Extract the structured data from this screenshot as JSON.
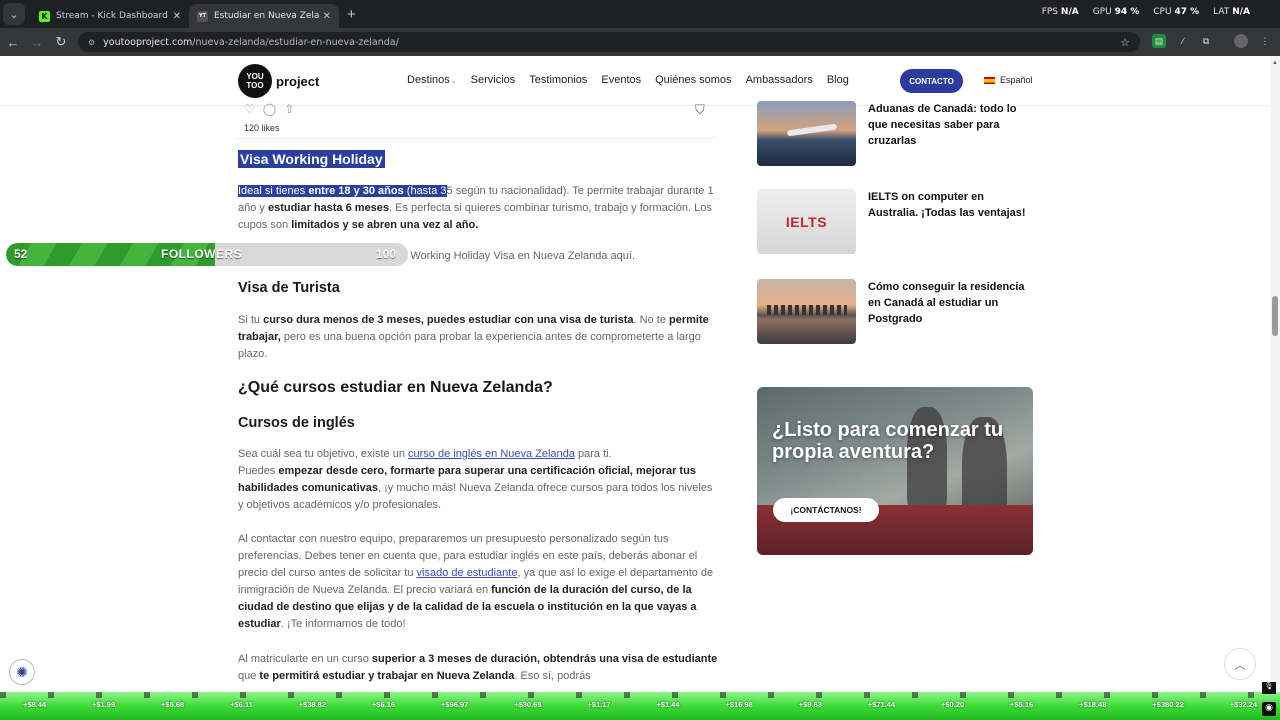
{
  "browser": {
    "tabs": [
      {
        "title": "Stream - Kick Dashboard",
        "favicon": "K"
      },
      {
        "title": "Estudiar en Nueva Zelanda con",
        "favicon": "YT"
      }
    ],
    "new_tab": "+",
    "stats": {
      "fps_label": "FPS",
      "fps_value": "N/A",
      "gpu_label": "GPU",
      "gpu_value": "94 %",
      "cpu_label": "CPU",
      "cpu_value": "47 %",
      "lat_label": "LAT",
      "lat_value": "N/A"
    },
    "url_host": "youtooproject.com",
    "url_path": "/nueva-zelanda/estudiar-en-nueva-zelanda/"
  },
  "site": {
    "logo_circle": "YOU TOO",
    "logo_text": "project",
    "nav": [
      "Destinos",
      "Servicios",
      "Testimonios",
      "Eventos",
      "Quiénes somos",
      "Ambassadors",
      "Blog"
    ],
    "contact": "CONTACTO",
    "language": "Español"
  },
  "post": {
    "likes": "120 likes"
  },
  "article": {
    "h_working_holiday": "Visa Working Holiday",
    "wh_sel_1": "Ideal si tienes ",
    "wh_sel_bold": "entre 18 y 30 años",
    "wh_sel_2": " (hasta 3",
    "wh_rest_1": "5 según tu nacionalidad). Te permite trabajar durante 1 año y ",
    "wh_bold_2": "estudiar hasta 6 meses",
    "wh_rest_2": ". Es perfecta si quieres combinar turismo, trabajo y formación. Los cupos son ",
    "wh_bold_3": "limitados y se abren una vez al año.",
    "wh_more": "Consulta más información sobre la Working Holiday Visa en Nueva Zelanda aquí.",
    "h_turista": "Visa de Turista",
    "t_1": "Si tu ",
    "t_bold_1": "curso dura menos de 3 meses, puedes estudiar con una visa de turista",
    "t_2": ". No te ",
    "t_bold_2": "permite trabajar,",
    "t_3": " pero es una buena opción para probar la experiencia antes de comprometerte a largo plazo.",
    "h_cursos_q": "¿Qué cursos estudiar en Nueva Zelanda?",
    "h_ingles": "Cursos de inglés",
    "i_1": "Sea cuál sea tu objetivo, existe un ",
    "i_link": "curso de inglés en Nueva Zelanda",
    "i_2": " para ti.",
    "i_3": "Puedes ",
    "i_bold_1": "empezar desde cero, formarte para superar una certificación oficial, mejorar tus habilidades comunicativas",
    "i_4": ", ¡y mucho más! Nueva Zelanda ofrece cursos para todos los niveles y objetivos académicos y/o profesionales.",
    "c_1": "Al contactar con nuestro equipo, prepararemos un presupuesto personalizado según tus preferencias. Debes tener en cuenta que, para estudiar inglés en este país, deberás abonar el precio del curso antes de solicitar tu ",
    "c_link": "visado de estudiante",
    "c_2": ", ya que así lo exige el departamento de inmigración de Nueva Zelanda. El precio variará en ",
    "c_bold": "función de la duración del curso, de la ciudad de destino que elijas y de la calidad de la escuela o institución en la que vayas a estudiar",
    "c_3": ". ¡Te informamos de todo!",
    "m_1": "Al matricularte en un curso ",
    "m_bold_1": "superior a 3 meses de duración, obtendrás una visa de estudiante",
    "m_2": " que ",
    "m_bold_2": "te permitirá estudiar y trabajar en Nueva Zelanda",
    "m_3": ". Eso sí, podrás"
  },
  "followers": {
    "current": "52",
    "label": "FOLLOWERS",
    "goal": "100",
    "progress": 0.52
  },
  "sidebar": {
    "posts": [
      {
        "title": "Aduanas de Canadá: todo lo que necesitas saber para cruzarlas"
      },
      {
        "title": "IELTS on computer en Australia. ¡Todas las ventajas!",
        "thumb_text": "IELTS"
      },
      {
        "title": "Cómo conseguir la residencia en Canadá al estudiar un Postgrado"
      }
    ],
    "banner_title": "¿Listo para comenzar tu propia aventura?",
    "banner_button": "¡CONTÁCTANOS!"
  },
  "ticker": [
    "+$8.44",
    "+$1.99",
    "+$5.68",
    "+$6.11",
    "+$38.82",
    "+$6.16",
    "+$96.97",
    "+$30.68",
    "+$1.17",
    "+$1.44",
    "+$16.98",
    "+$9.63",
    "+$71.44",
    "+$0.20",
    "+$5.16",
    "+$18.48",
    "+$380.22",
    "+$32.24"
  ],
  "colors": {
    "brand_blue": "#2b3b9e",
    "selection": "#2a3f9e",
    "followers_green": "#3fae39",
    "ticker_green": "#3ddc3a"
  }
}
